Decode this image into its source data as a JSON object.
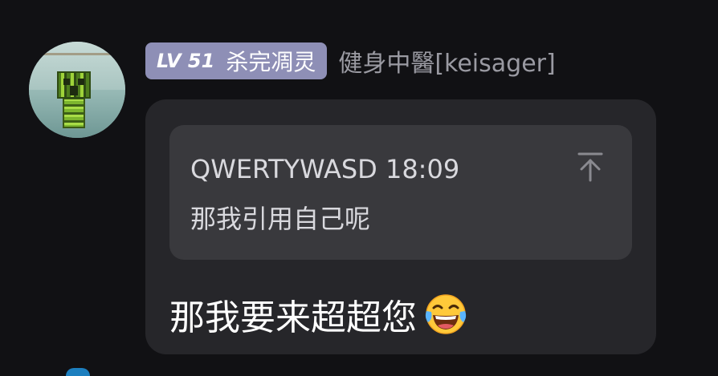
{
  "message": {
    "sender": {
      "level": "LV 51",
      "title": "杀完凋灵",
      "name": "健身中醫[keisager]",
      "avatar_icon": "creeper-avatar"
    },
    "quote": {
      "author": "QWERTYWASD",
      "time": "18:09",
      "text": "那我引用自己呢",
      "jump_icon": "arrow-up-to-top-icon"
    },
    "text": "那我要来超超您",
    "emoji": "face-with-tears-of-joy"
  },
  "colors": {
    "background": "#111114",
    "bubble": "#26262a",
    "quote_bg": "#39393d",
    "badge_bg": "#8e8fb6",
    "username": "#9a9aa2",
    "text": "#ffffff"
  }
}
